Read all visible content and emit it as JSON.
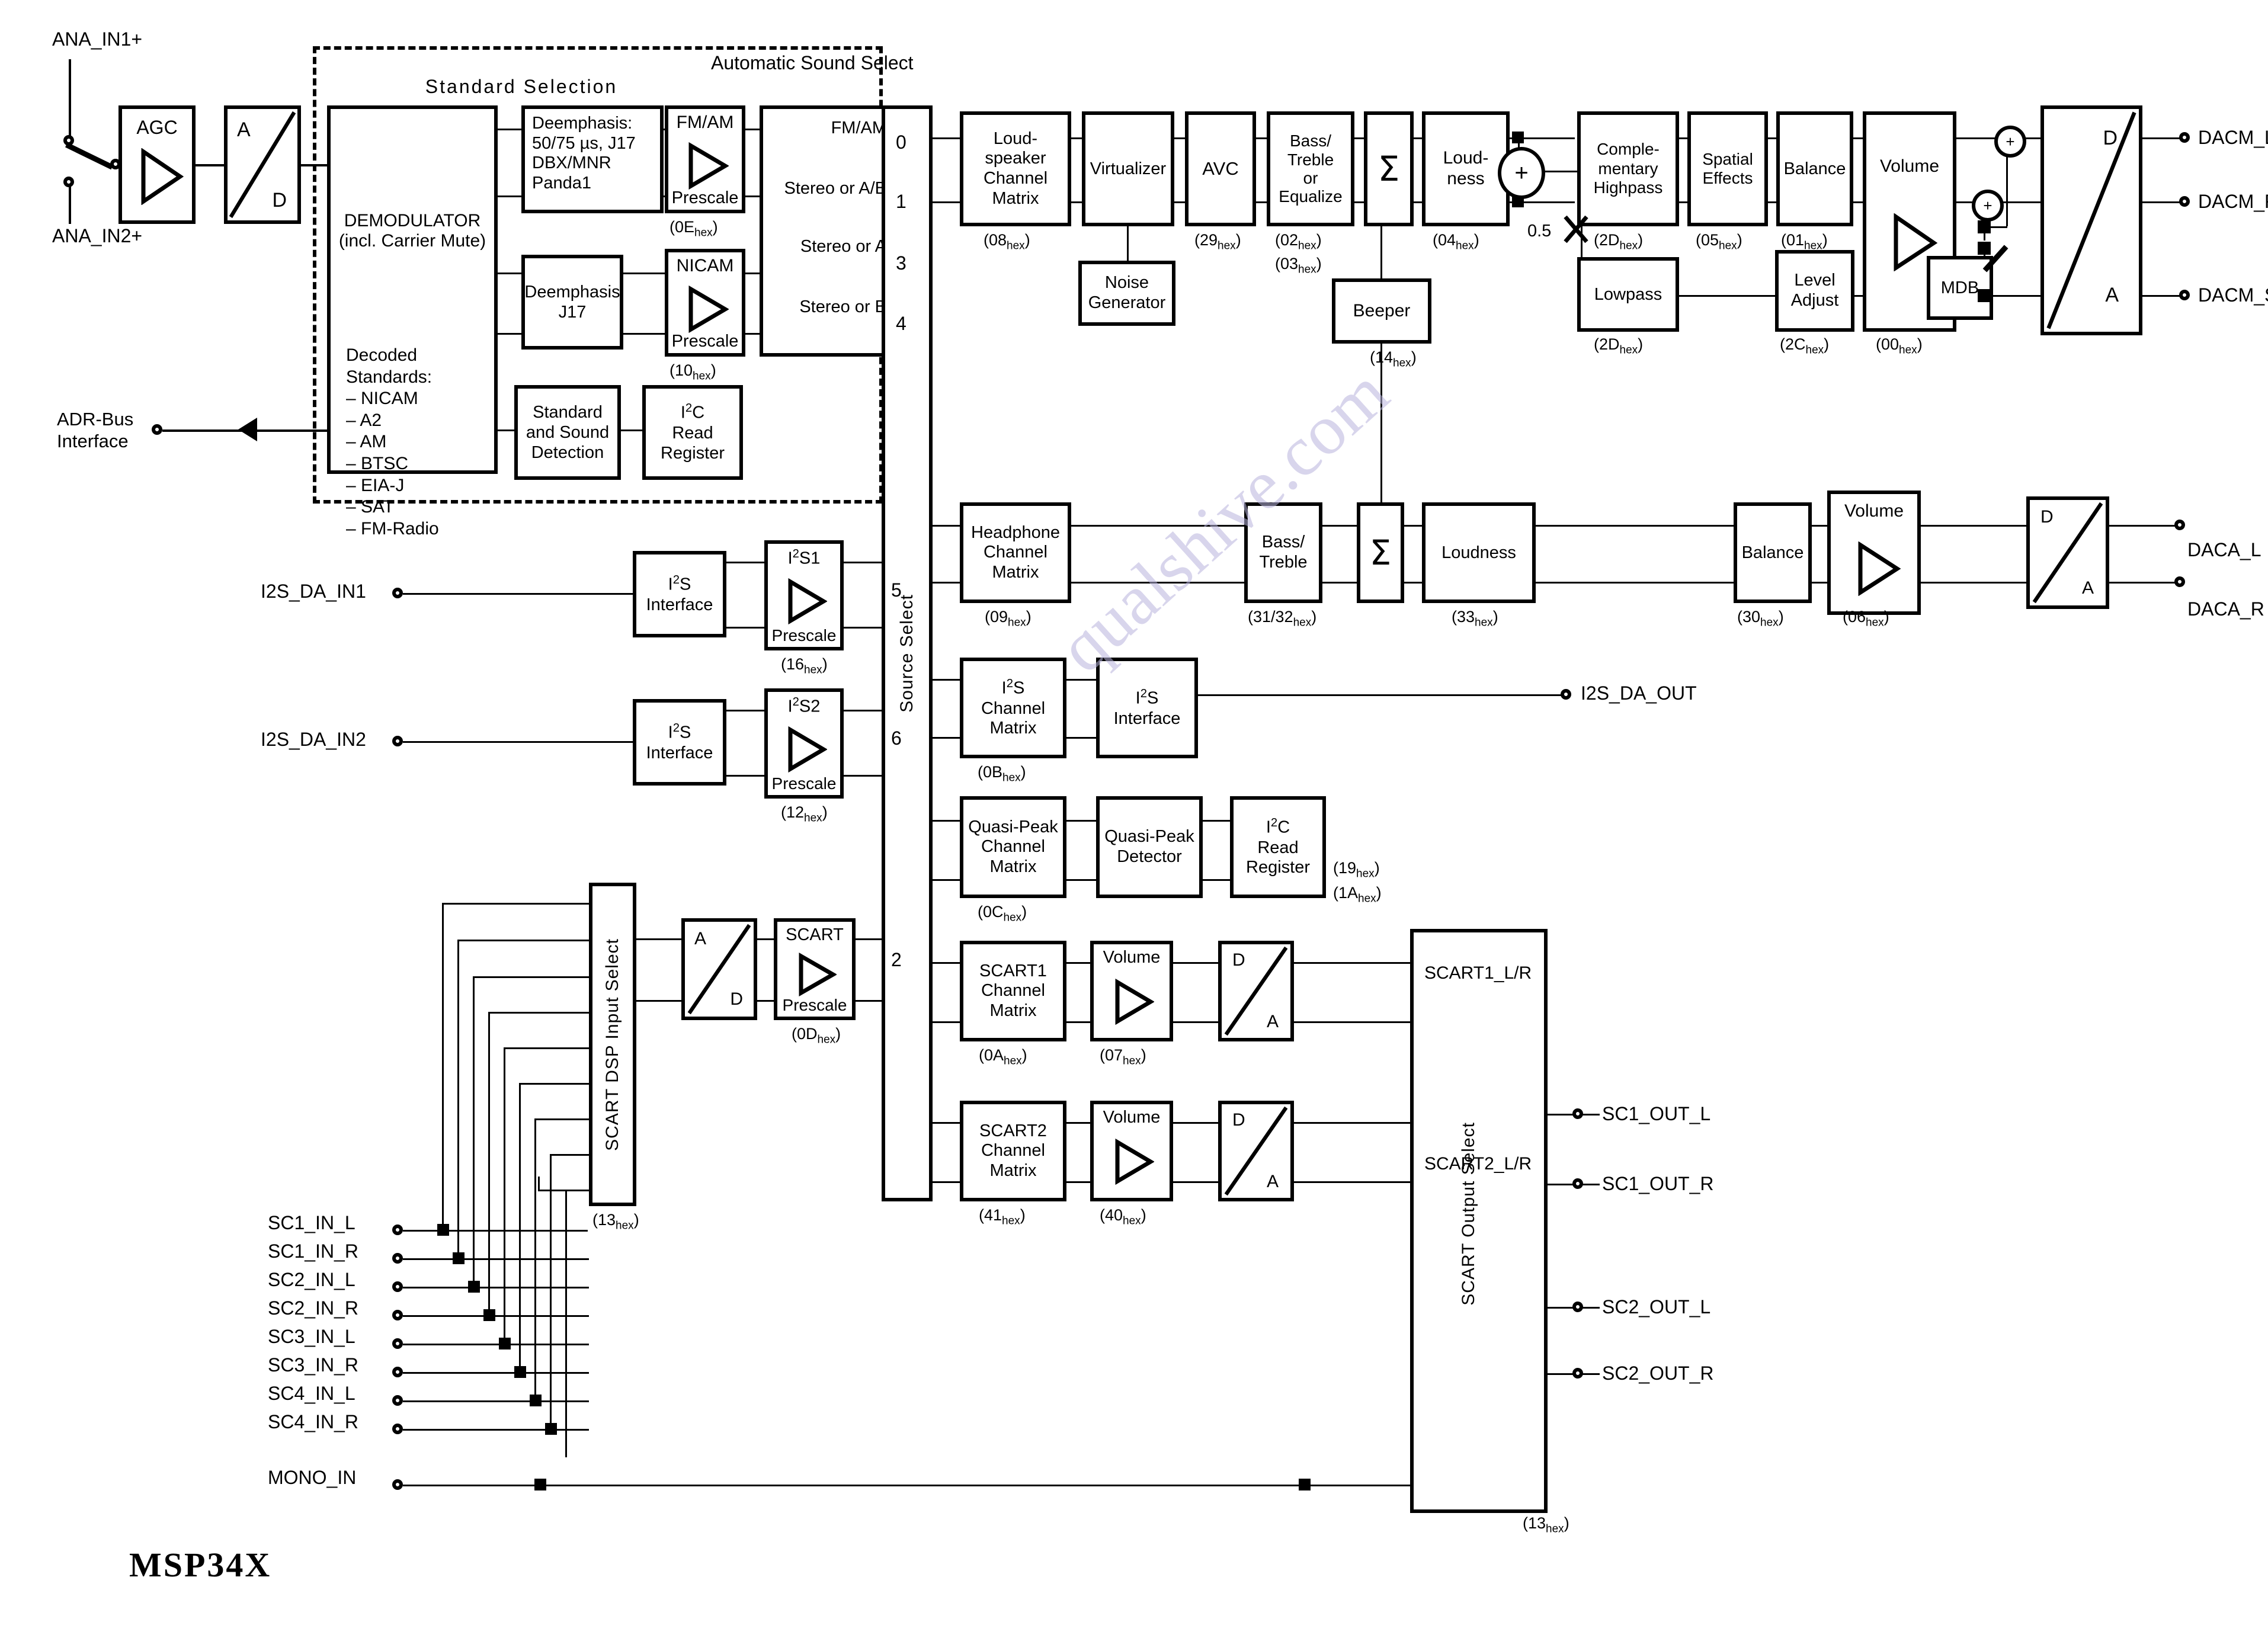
{
  "title": "MSP34X",
  "watermark": "qualshive.com",
  "regions": {
    "standard_selection": "Standard Selection",
    "automatic_sound_select": "Automatic Sound Select"
  },
  "inputs": {
    "ana_in1": "ANA_IN1+",
    "ana_in2": "ANA_IN2+",
    "adr_bus": "ADR-Bus\nInterface",
    "adr_bus_l1": "ADR-Bus",
    "adr_bus_l2": "Interface",
    "i2s_da_in1": "I2S_DA_IN1",
    "i2s_da_in2": "I2S_DA_IN2",
    "scart_inputs": [
      "SC1_IN_L",
      "SC1_IN_R",
      "SC2_IN_L",
      "SC2_IN_R",
      "SC3_IN_L",
      "SC3_IN_R",
      "SC4_IN_L",
      "SC4_IN_R",
      "MONO_IN"
    ]
  },
  "outputs": {
    "dacm_l": "DACM_L",
    "dacm_r": "DACM_R",
    "dacm_sub": "DACM_SUB",
    "daca_l": "DACA_L",
    "daca_r": "DACA_R",
    "i2s_da_out": "I2S_DA_OUT",
    "scart_outputs": [
      "SC1_OUT_L",
      "SC1_OUT_R",
      "SC2_OUT_L",
      "SC2_OUT_R"
    ]
  },
  "blocks": {
    "agc": "AGC",
    "adc_a": "A",
    "adc_d": "D",
    "demodulator_l1": "DEMODULATOR",
    "demodulator_l2": "(incl. Carrier Mute)",
    "decoded_title_l1": "Decoded",
    "decoded_title_l2": "Standards:",
    "decoded_standards": [
      "– NICAM",
      "– A2",
      "– AM",
      "– BTSC",
      "– EIA-J",
      "– SAT",
      "– FM-Radio"
    ],
    "deemphasis_main_l1": "Deemphasis:",
    "deemphasis_main_l2": "50/75 µs, J17",
    "deemphasis_main_l3": "DBX/MNR",
    "deemphasis_main_l4": "Panda1",
    "deemphasis_j17_l1": "Deemphasis",
    "deemphasis_j17_l2": "J17",
    "fmam_prescale_l1": "FM/AM",
    "fmam_prescale_l2": "Prescale",
    "nicam_prescale_l1": "NICAM",
    "nicam_prescale_l2": "Prescale",
    "std_sound_detect_l1": "Standard",
    "std_sound_detect_l2": "and Sound",
    "std_sound_detect_l3": "Detection",
    "i2c_read_reg_l1": "I2C",
    "i2c_read_reg_l2": "Read",
    "i2c_read_reg_l3": "Register",
    "auto_sound_rows": [
      "FM/AM",
      "Stereo or A/B",
      "Stereo or A",
      "Stereo or B"
    ],
    "source_select": "Source Select",
    "source_numbers": [
      "0",
      "1",
      "3",
      "4",
      "5",
      "6",
      "2"
    ],
    "loudspeaker_matrix_l1": "Loud-",
    "loudspeaker_matrix_l2": "speaker",
    "loudspeaker_matrix_l3": "Channel",
    "loudspeaker_matrix_l4": "Matrix",
    "virtualizer": "Virtualizer",
    "noise_generator_l1": "Noise",
    "noise_generator_l2": "Generator",
    "avc": "AVC",
    "bass_treble_eq_l1": "Bass/",
    "bass_treble_eq_l2": "Treble",
    "bass_treble_eq_l3": "or",
    "bass_treble_eq_l4": "Equalize",
    "sigma": "Σ",
    "beeper": "Beeper",
    "loudness_l1": "Loud-",
    "loudness_l2": "ness",
    "gain_05": "0.5",
    "comp_highpass_l1": "Comple-",
    "comp_highpass_l2": "mentary",
    "comp_highpass_l3": "Highpass",
    "lowpass": "Lowpass",
    "spatial_effects_l1": "Spatial",
    "spatial_effects_l2": "Effects",
    "balance": "Balance",
    "level_adjust_l1": "Level",
    "level_adjust_l2": "Adjust",
    "volume": "Volume",
    "mdb": "MDB",
    "dac_d": "D",
    "dac_a": "A",
    "headphone_matrix_l1": "Headphone",
    "headphone_matrix_l2": "Channel",
    "headphone_matrix_l3": "Matrix",
    "bass_treble_l1": "Bass/",
    "bass_treble_l2": "Treble",
    "loudness_hp": "Loudness",
    "i2s_interface_l1": "I2S",
    "i2s_interface_l2": "Interface",
    "i2s1_prescale_l1": "I2S1",
    "i2s1_prescale_l2": "Prescale",
    "i2s2_prescale_l1": "I2S2",
    "i2s2_prescale_l2": "Prescale",
    "i2s_channel_matrix_l1": "I2S",
    "i2s_channel_matrix_l2": "Channel",
    "i2s_channel_matrix_l3": "Matrix",
    "quasi_peak_matrix_l1": "Quasi-Peak",
    "quasi_peak_matrix_l2": "Channel",
    "quasi_peak_matrix_l3": "Matrix",
    "quasi_peak_detector_l1": "Quasi-Peak",
    "quasi_peak_detector_l2": "Detector",
    "scart_dsp_input_select": "SCART DSP Input Select",
    "scart_prescale_l1": "SCART",
    "scart_prescale_l2": "Prescale",
    "scart1_matrix_l1": "SCART1",
    "scart1_matrix_l2": "Channel",
    "scart1_matrix_l3": "Matrix",
    "scart2_matrix_l1": "SCART2",
    "scart2_matrix_l2": "Channel",
    "scart2_matrix_l3": "Matrix",
    "scart_output_select": "SCART Output Select",
    "scart1_lr": "SCART1_L/R",
    "scart2_lr": "SCART2_L/R"
  },
  "hex_labels": {
    "fmam_prescale": "0E",
    "nicam_prescale": "10",
    "loudspeaker_matrix": "08",
    "avc": "29",
    "bass_treble_eq_a": "02",
    "bass_treble_eq_b": "03",
    "loudness": "04",
    "beeper": "14",
    "comp_highpass": "2D",
    "lowpass": "2D",
    "spatial_effects": "05",
    "balance_main": "01",
    "level_adjust": "2C",
    "volume_main": "00",
    "headphone_matrix": "09",
    "bass_treble_hp": "31/32",
    "loudness_hp": "33",
    "balance_hp": "30",
    "volume_hp": "06",
    "i2s1_prescale": "16",
    "i2s2_prescale": "12",
    "i2s_channel_matrix": "0B",
    "quasi_peak_matrix": "0C",
    "i2c_read_reg_a": "19",
    "i2c_read_reg_b": "1A",
    "scart_dsp_input_select": "13",
    "scart_prescale": "0D",
    "scart1_matrix": "0A",
    "scart1_volume": "07",
    "scart2_matrix": "41",
    "scart2_volume": "40",
    "scart_output_select": "13",
    "hex_suffix": "hex"
  }
}
